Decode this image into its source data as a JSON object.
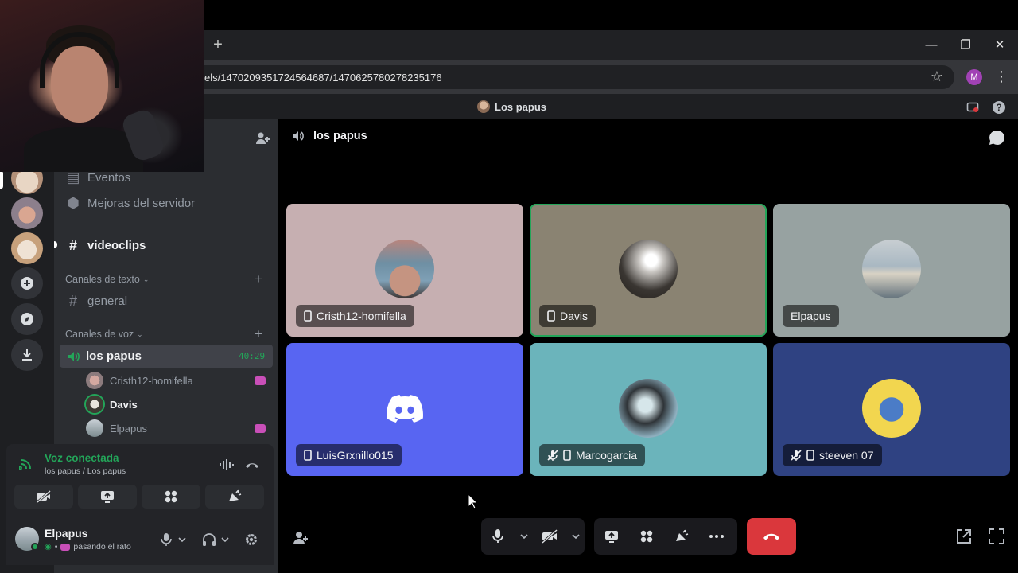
{
  "browser": {
    "new_tab": "+",
    "url": "els/1470209351724564687/1470625780278235176",
    "profile_initial": "M",
    "window_controls": [
      "minimize-icon",
      "restore-icon",
      "close-icon"
    ]
  },
  "discord_title": "Los papus",
  "channels": {
    "eventos": "Eventos",
    "mejoras": "Mejoras del servidor",
    "videoclips": "videoclips",
    "cat_text": "Canales de texto",
    "general": "general",
    "cat_voice": "Canales de voz",
    "voice_channel": "los papus",
    "voice_timer": "40:29",
    "voice_users": [
      "Cristh12-homifella",
      "Davis",
      "Elpapus"
    ]
  },
  "voice_panel": {
    "status": "Voz conectada",
    "location": "los papus / Los papus"
  },
  "user": {
    "name": "Elpapus",
    "status": "pasando el rato"
  },
  "stage": {
    "title": "los papus",
    "tiles": [
      {
        "name": "Cristh12-homifella",
        "bg": "#c6afb1"
      },
      {
        "name": "Davis",
        "bg": "#8a8372",
        "speaking": true
      },
      {
        "name": "Elpapus",
        "bg": "#97a2a1"
      },
      {
        "name": "LuisGrxnillo015",
        "bg": "#5865f2"
      },
      {
        "name": "Marcogarcia",
        "bg": "#6bb4bb"
      },
      {
        "name": "steeven 07",
        "bg": "#2f4282"
      }
    ]
  },
  "colors": {
    "accent_green": "#23a559",
    "hangup_red": "#da373c",
    "blurple": "#5865f2"
  }
}
